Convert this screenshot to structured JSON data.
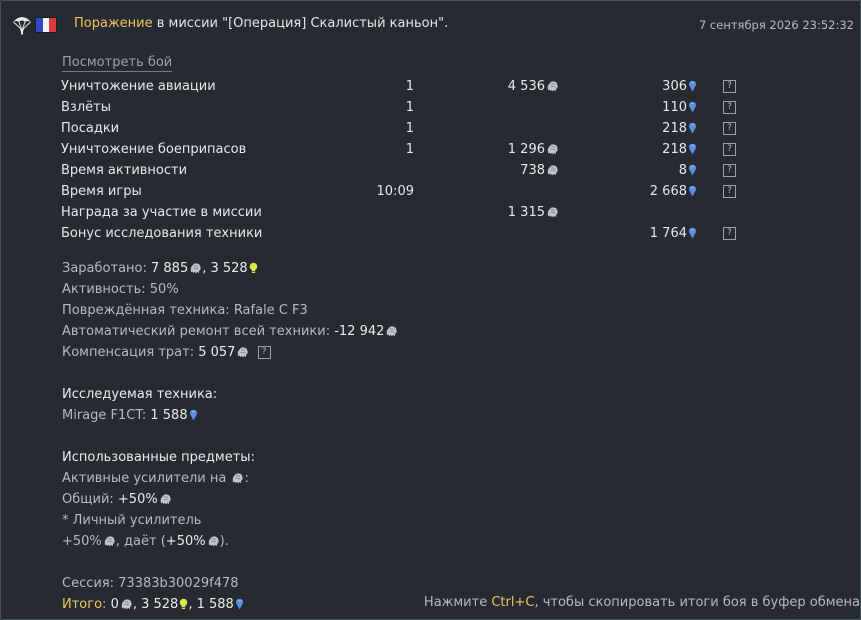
{
  "header": {
    "result": "Поражение",
    "mission_text": " в миссии \"[Операция] Скалистый каньон\".",
    "datetime": "7 сентября 2026 23:52:32"
  },
  "view_battle_label": "Посмотреть бой",
  "rows": [
    {
      "name": "Уничтожение авиации",
      "count": "1",
      "sl": "4 536",
      "rp": "306"
    },
    {
      "name": "Взлёты",
      "count": "1",
      "sl": "",
      "rp": "110"
    },
    {
      "name": "Посадки",
      "count": "1",
      "sl": "",
      "rp": "218"
    },
    {
      "name": "Уничтожение боеприпасов",
      "count": "1",
      "sl": "1 296",
      "rp": "218"
    },
    {
      "name": "Время активности",
      "count": "",
      "sl": "738",
      "rp": "8"
    },
    {
      "name": "Время игры",
      "count": "10:09",
      "sl": "",
      "rp": "2 668"
    },
    {
      "name": "Награда за участие в миссии",
      "count": "",
      "sl": "1 315",
      "rp": ""
    },
    {
      "name": "Бонус исследования техники",
      "count": "",
      "sl": "",
      "rp": "1 764"
    }
  ],
  "help_glyph": "?",
  "stats": {
    "earned_label": "Заработано: ",
    "earned_sl": "7 885",
    "earned_rp": "3 528",
    "activity": "Активность: 50%",
    "damaged_label": "Повреждённая техника: ",
    "damaged_vehicle": "Rafale C F3",
    "repair_label": "Автоматический ремонт всей техники: ",
    "repair_value": "-12 942",
    "compensation_label": "Компенсация трат: ",
    "compensation_value": "5 057"
  },
  "research": {
    "title": "Исследуемая техника:",
    "vehicle": "Mirage F1CT: ",
    "rp": "1 588"
  },
  "items": {
    "title": "Использованные предметы:",
    "active_boosters": "Активные усилители на ",
    "general_label": "Общий: ",
    "general_value": "+50%",
    "personal": "* Личный усилитель",
    "personal_value": "+50%",
    "gives_label": ", даёт (",
    "gives_value": "+50%",
    "gives_end": ")."
  },
  "session": "Сессия: 73383b30029f478",
  "total": {
    "label": "Итого",
    "colon": ": ",
    "sl": "0",
    "rp": "3 528",
    "research_rp": "1 588"
  },
  "copy_hint": {
    "before": "Нажмите ",
    "key": "Ctrl+C",
    "after": ", чтобы скопировать итоги боя в буфер обмена"
  },
  "colors": {
    "background": "#262b32",
    "accent_yellow": "#f0c45b",
    "rp_blue": "#5a8ee0",
    "convertible_rp": "#d9e84a",
    "silver_lions": "#bfc4c9"
  },
  "icons": {
    "silver_lions": "silver-lion-icon",
    "research_points": "research-point-icon",
    "convertible_rp": "lightbulb-icon",
    "help": "help-icon",
    "flag": "france-flag-icon",
    "parachute": "parachute-icon"
  }
}
